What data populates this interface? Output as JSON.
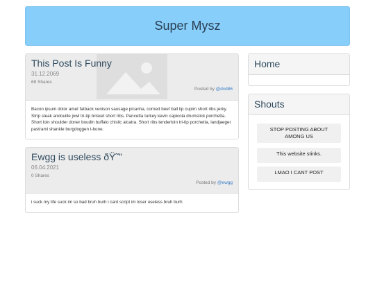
{
  "site": {
    "title": "Super Mysz"
  },
  "posts": [
    {
      "title": "This Post Is Funny",
      "date": "31.12.2069",
      "shares": "69 Shares",
      "posted_by_label": "Posted by",
      "author": "@dxd86",
      "body": "Bacon ipsum dolor amet fatback venison sausage picanha, corned beef ball tip cupim short ribs jerky. Strip steak andouille jowl tri-tip brisket short ribs. Pancetta turkey kevin capicola drumstick porchetta. Short loin shoulder doner boudin buffalo chislic alcatra. Short ribs tenderloin tri-tip porchetta, landjaeger pastrami shankle burgdoggen t-bone."
    },
    {
      "title": "Ewgg is useless ðŸ˜”",
      "date": "06.04.2021",
      "shares": "0 Shares",
      "posted_by_label": "Posted by",
      "author": "@ewgg",
      "body": "i suck my life suck im so bad bruh burh i cant script im loser useless bruh burh"
    }
  ],
  "sidebar": {
    "home_title": "Home",
    "shouts_title": "Shouts",
    "shouts": [
      "STOP POSTING ABOUT AMONG US",
      "This website stinks.",
      "LMAO I CANT POST"
    ]
  }
}
